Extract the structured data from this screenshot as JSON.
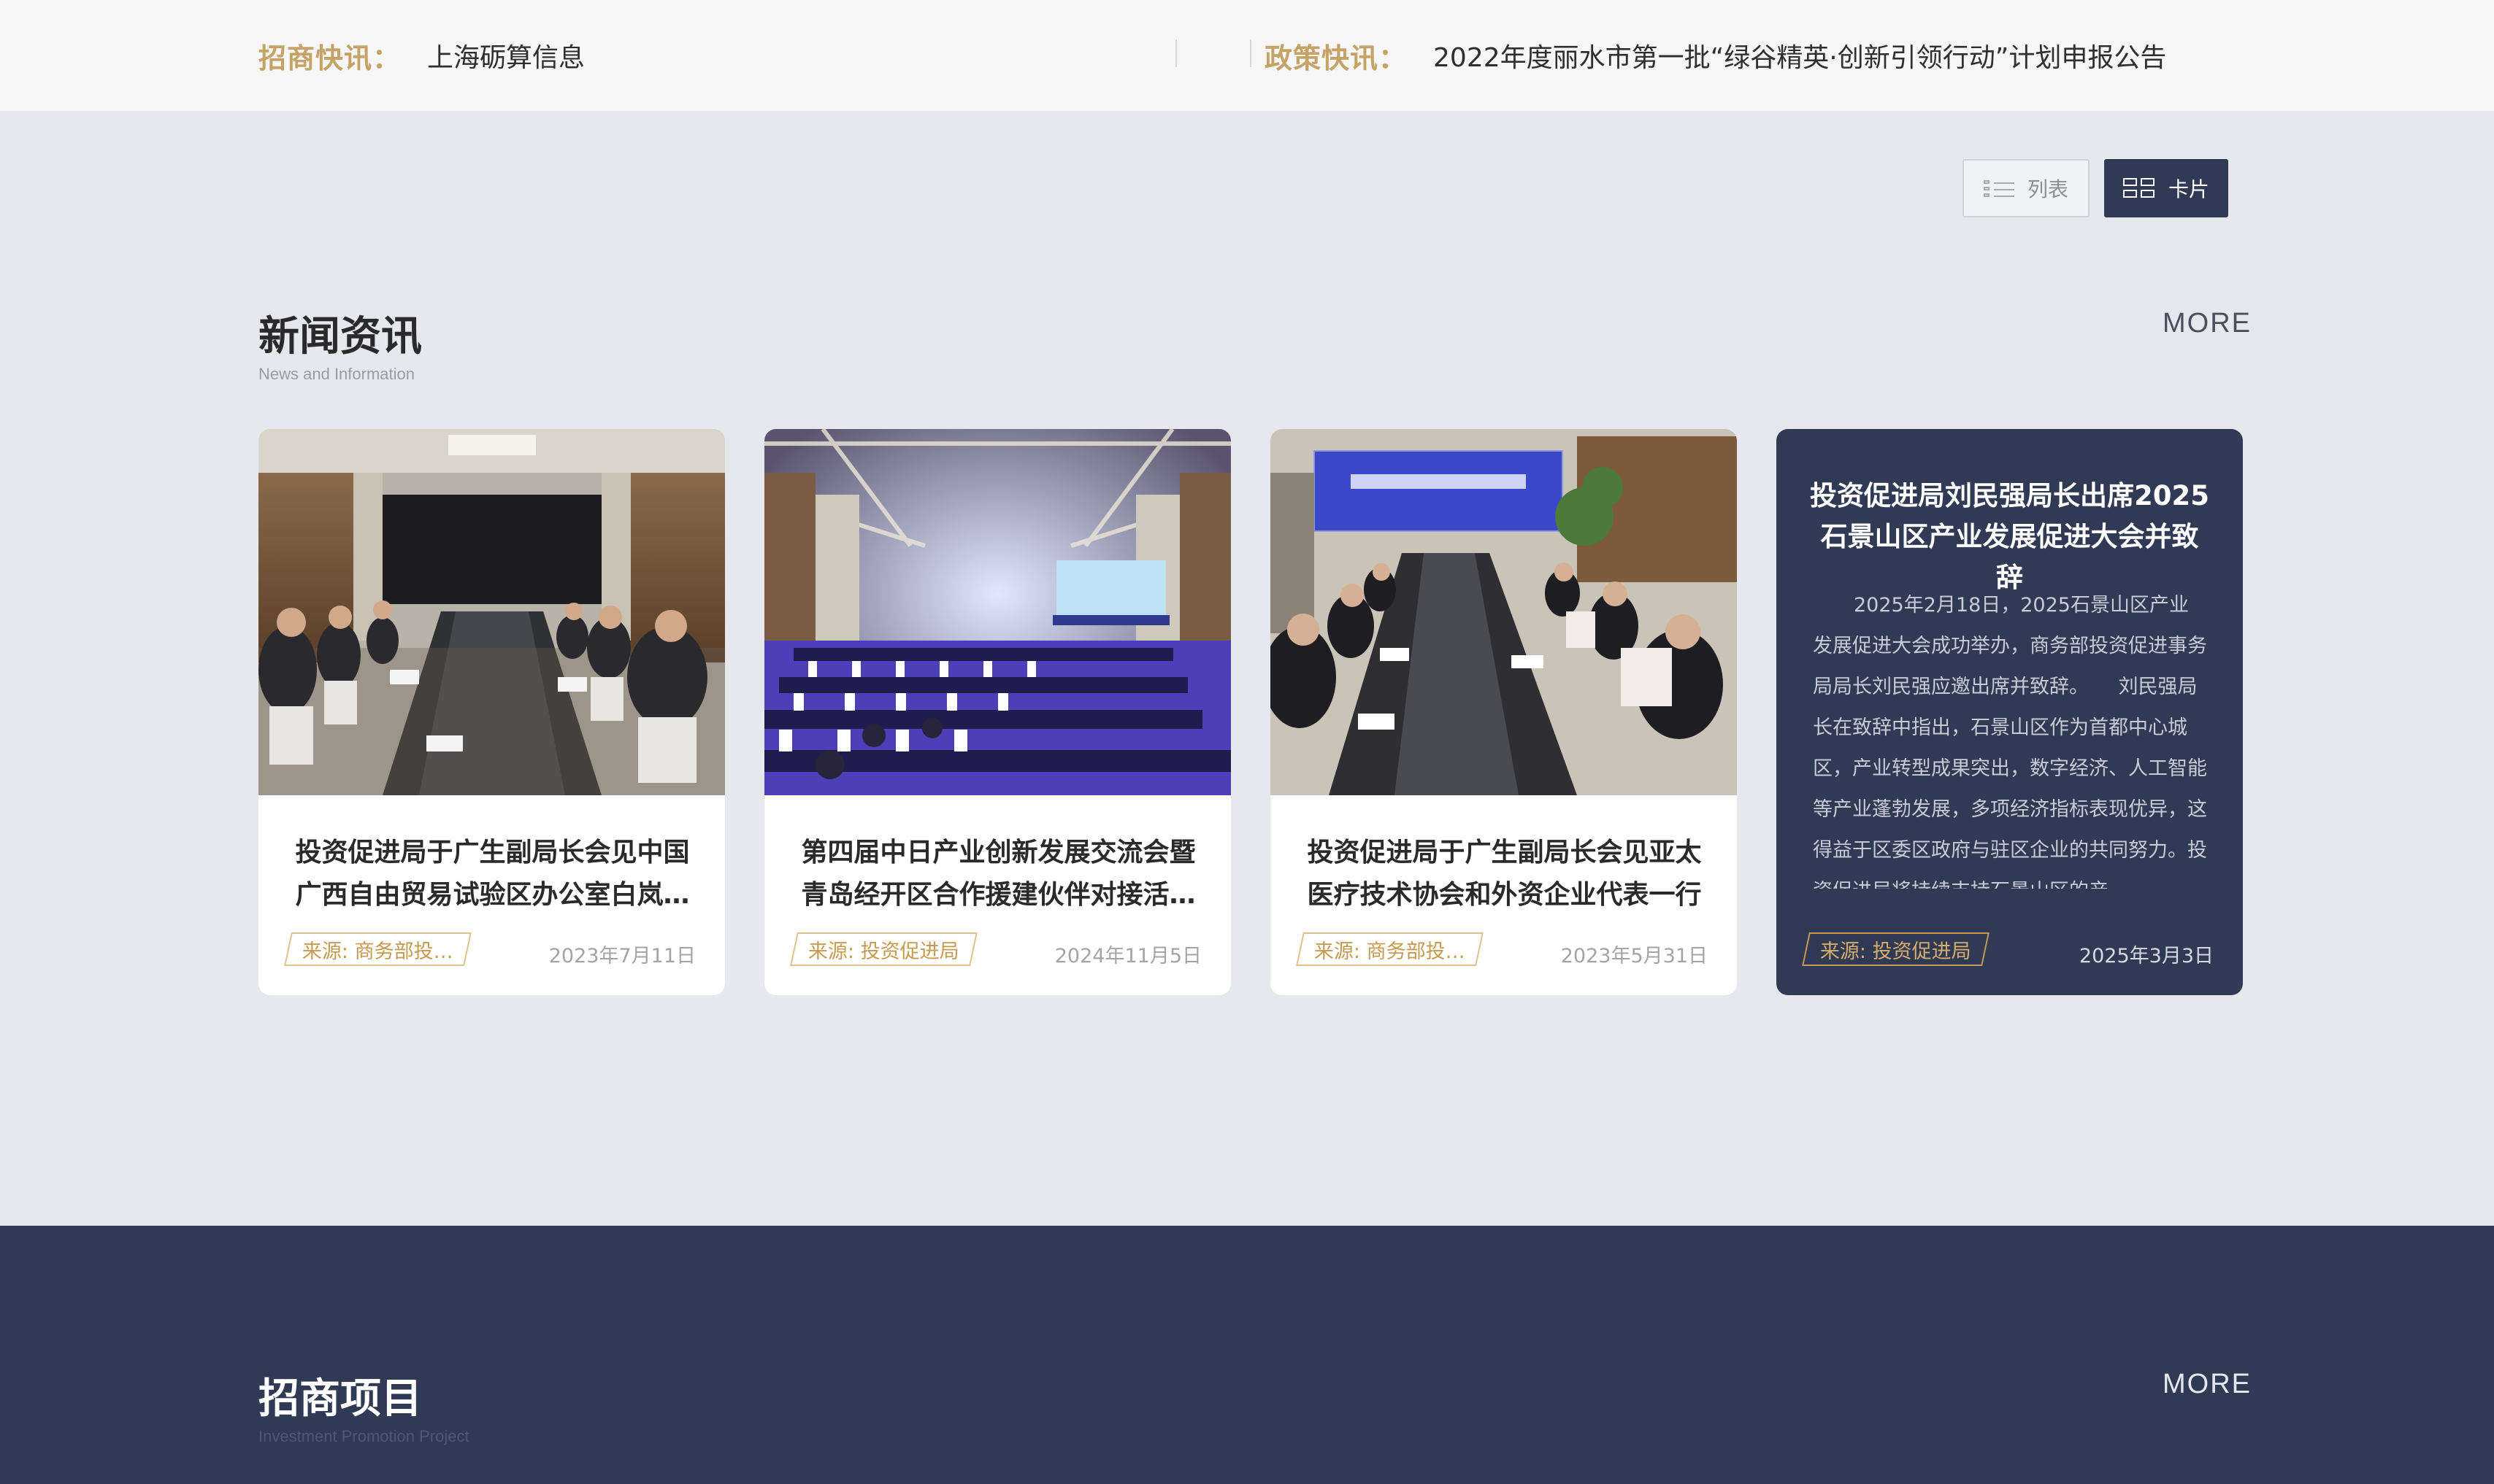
{
  "ticker": {
    "left_label": "招商快讯：",
    "left_text": "上海砺算信息",
    "right_label": "政策快讯：",
    "right_text": "2022年度丽水市第一批“绿谷精英·创新引领行动”计划申报公告"
  },
  "view_toggle": {
    "list_label": "列表",
    "card_label": "卡片",
    "active": "card"
  },
  "news": {
    "title": "新闻资讯",
    "subtitle": "News and Information",
    "more": "MORE",
    "cards": [
      {
        "title": "投资促进局于广生副局长会见中国广西自由贸易试验区办公室白岚…",
        "source": "来源: 商务部投…",
        "date": "2023年7月11日",
        "image": "meeting-room-photo"
      },
      {
        "title": "第四届中日产业创新发展交流会暨青岛经开区合作援建伙伴对接活…",
        "source": "来源: 投资促进局",
        "date": "2024年11月5日",
        "image": "conference-hall-photo"
      },
      {
        "title": "投资促进局于广生副局长会见亚太医疗技术协会和外资企业代表一行",
        "source": "来源: 商务部投…",
        "date": "2023年5月31日",
        "image": "meeting-table-photo"
      },
      {
        "title": "投资促进局刘民强局长出席2025石景山区产业发展促进大会并致辞",
        "summary": "2025年2月18日，2025石景山区产业发展促进大会成功举办，商务部投资促进事务局局长刘民强应邀出席并致辞。　　刘民强局长在致辞中指出，石景山区作为首都中心城区，产业转型成果突出，数字经济、人工智能等产业蓬勃发展，多项经济指标表现优异，这得益于区委区政府与驻区企业的共同努力。投资促进局将持续支持石景山区的产",
        "source": "来源: 投资促进局",
        "date": "2025年3月3日"
      }
    ]
  },
  "projects": {
    "title": "招商项目",
    "subtitle": "Investment Promotion Project",
    "more": "MORE"
  },
  "colors": {
    "accent_gold": "#c5a266",
    "navy": "#313a55",
    "page_bg": "#e7e8ed"
  }
}
